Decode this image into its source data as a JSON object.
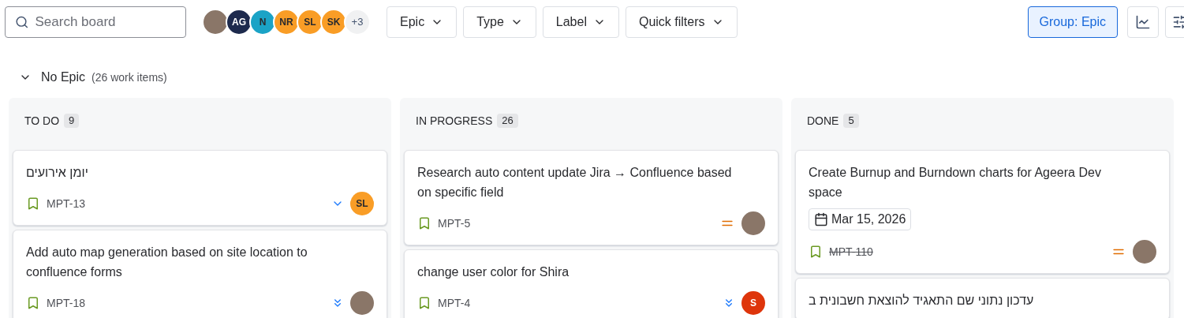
{
  "toolbar": {
    "search": {
      "placeholder": "Search board"
    },
    "avatars": [
      {
        "kind": "photo"
      },
      {
        "kind": "initials",
        "label": "AG",
        "color": "#1d2a4d"
      },
      {
        "kind": "initials",
        "label": "N",
        "color": "#1ba3c6"
      },
      {
        "kind": "initials",
        "label": "NR",
        "color": "#f99d26"
      },
      {
        "kind": "initials",
        "label": "SL",
        "color": "#f99d26"
      },
      {
        "kind": "initials",
        "label": "SK",
        "color": "#f99d26"
      },
      {
        "kind": "more",
        "label": "+3"
      }
    ],
    "filters": [
      "Epic",
      "Type",
      "Label",
      "Quick filters"
    ],
    "group_button": {
      "label": "Group: Epic",
      "selected": true
    }
  },
  "group": {
    "title": "No Epic",
    "count": "(26 work items)",
    "expanded": true
  },
  "columns": [
    {
      "title": "TO DO",
      "count": "9",
      "cards": [
        {
          "title": "יומן אירועים",
          "key": "MPT-13",
          "done": false,
          "priority": {
            "kind": "low"
          },
          "assignee": {
            "kind": "initials",
            "label": "SL",
            "color": "#f99d26"
          }
        },
        {
          "title": "Add auto map generation based on site location to confluence forms",
          "key": "MPT-18",
          "done": false,
          "priority": {
            "kind": "lowest"
          },
          "assignee": {
            "kind": "photo"
          }
        }
      ]
    },
    {
      "title": "IN PROGRESS",
      "count": "26",
      "cards": [
        {
          "title": "Research auto content update Jira → Confluence based on specific field",
          "key": "MPT-5",
          "done": false,
          "priority": {
            "kind": "medium"
          },
          "assignee": {
            "kind": "photo"
          }
        },
        {
          "title": "change user color for Shira",
          "key": "MPT-4",
          "done": false,
          "priority": {
            "kind": "lowest"
          },
          "assignee": {
            "kind": "initials",
            "label": "S",
            "color": "#de350b"
          }
        }
      ]
    },
    {
      "title": "DONE",
      "count": "5",
      "cards": [
        {
          "title": "Create Burnup and Burndown charts for Ageera Dev space",
          "due": "Mar 15, 2026",
          "key": "MPT-110",
          "done": true,
          "priority": {
            "kind": "medium"
          },
          "assignee": {
            "kind": "photo"
          }
        },
        {
          "title": "עדכון נתוני שם התאגיד להוצאת חשבונית ב"
        }
      ]
    }
  ]
}
